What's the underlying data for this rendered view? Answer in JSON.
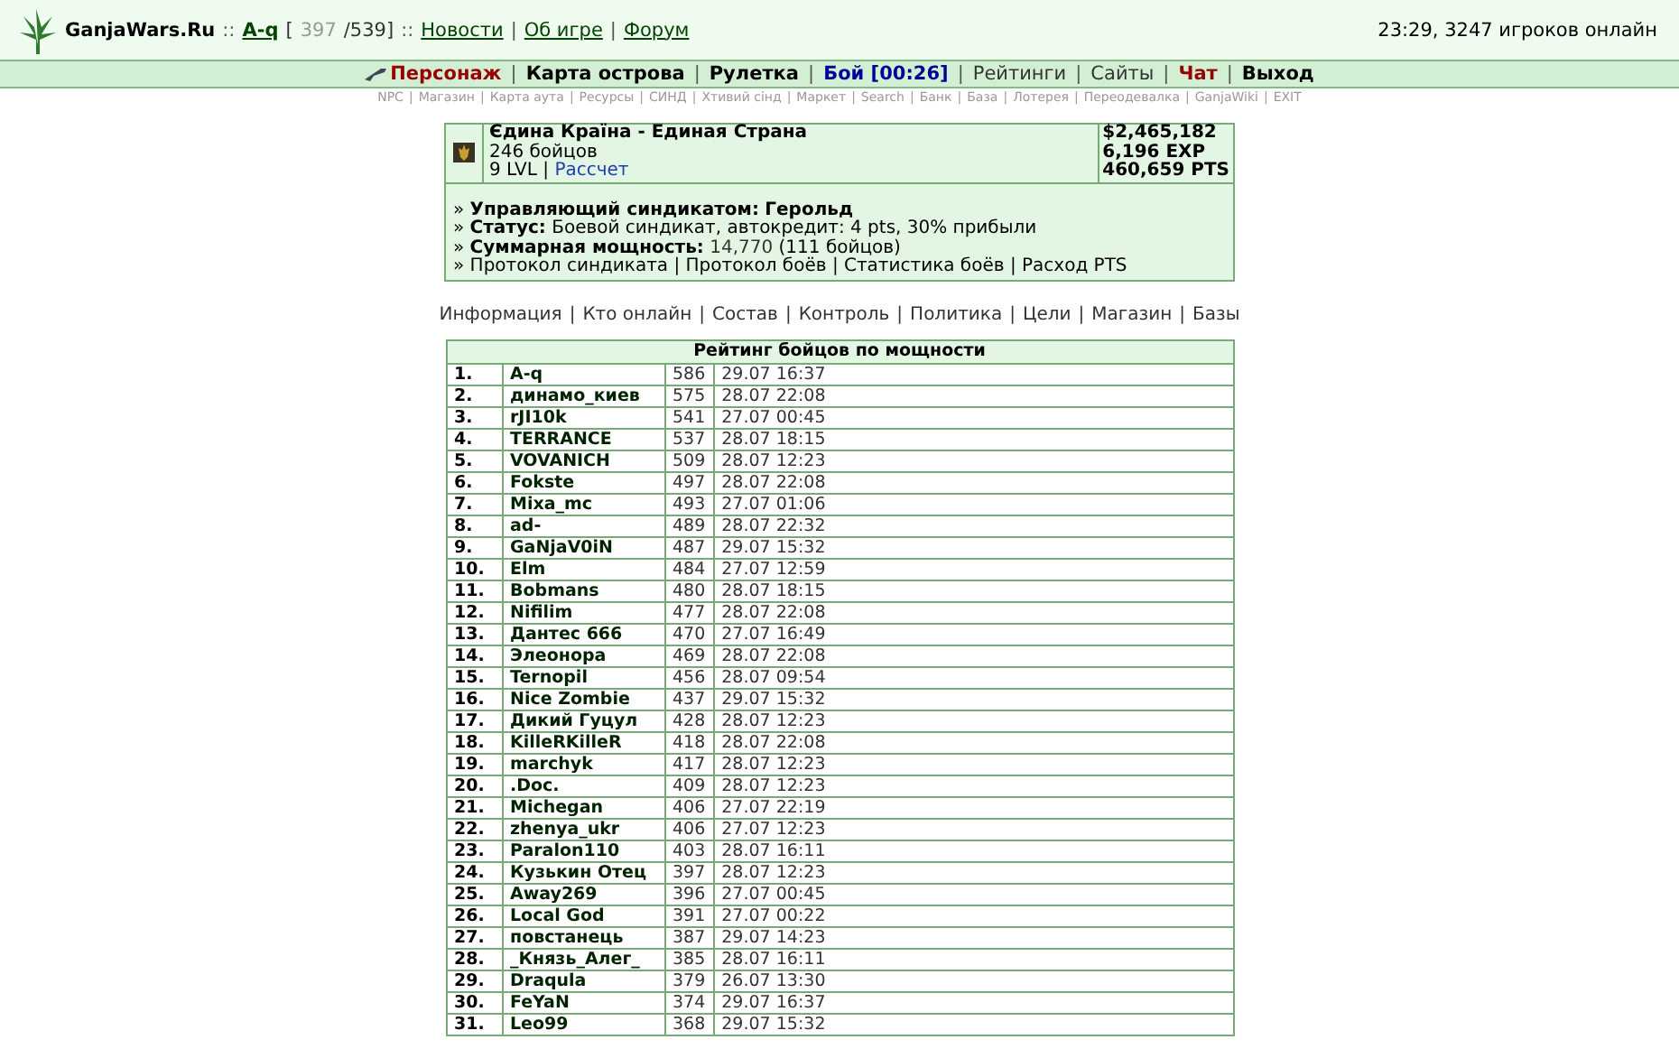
{
  "header": {
    "segments": [
      {
        "kind": "site",
        "text": "GanjaWars.Ru"
      },
      {
        "kind": "sep",
        "text": "::"
      },
      {
        "kind": "user",
        "text": "A-q"
      },
      {
        "kind": "plain",
        "text": "["
      },
      {
        "kind": "muted",
        "text": "397"
      },
      {
        "kind": "plain",
        "text": "/539]"
      },
      {
        "kind": "sep",
        "text": "::"
      },
      {
        "kind": "link",
        "text": "Новости"
      },
      {
        "kind": "sep",
        "text": "|"
      },
      {
        "kind": "link",
        "text": "Об игре"
      },
      {
        "kind": "sep",
        "text": "|"
      },
      {
        "kind": "link",
        "text": "Форум"
      }
    ],
    "status": "23:29, 3247 игроков онлайн"
  },
  "nav": {
    "separator": "|",
    "items": [
      {
        "label": "Персонаж",
        "kind": "red"
      },
      {
        "label": "Карта острова",
        "kind": "bold"
      },
      {
        "label": "Рулетка",
        "kind": "bold"
      },
      {
        "label": "Бой [00:26]",
        "kind": "blue"
      },
      {
        "label": "Рейтинги",
        "kind": "plain"
      },
      {
        "label": "Сайты",
        "kind": "plain"
      },
      {
        "label": "Чат",
        "kind": "red"
      },
      {
        "label": "Выход",
        "kind": "bold"
      }
    ]
  },
  "subnav": {
    "separator": "|",
    "items": [
      "NPC",
      "Магазин",
      "Карта аута",
      "Ресурсы",
      "СИНД",
      "Хтивий сінд",
      "Маркет",
      "Search",
      "Банк",
      "База",
      "Лотерея",
      "Переодевалка",
      "GanjaWiki",
      "EXIT"
    ]
  },
  "syndicate": {
    "name": "Єдина Країна - Единая Страна",
    "members": "246 бойцов",
    "level": "9 LVL",
    "separator": "|",
    "level_link": "Рассчет",
    "stats": [
      "$2,465,182",
      "6,196 EXP",
      "460,659 PTS"
    ],
    "lines": [
      [
        {
          "kind": "text",
          "text": "» **Управляющий синдикатом:** "
        },
        {
          "kind": "strong-link",
          "text": "Герольд"
        }
      ],
      [
        {
          "kind": "text",
          "text": "» **Статус:** Боевой синдикат, автокредит: 4 pts, 30% прибыли"
        }
      ],
      [
        {
          "kind": "text",
          "text": "» **Суммарная мощность:** "
        },
        {
          "kind": "link",
          "text": "14,770"
        },
        {
          "kind": "text",
          "text": " (111 бойцов)"
        }
      ],
      [
        {
          "kind": "text",
          "text": "» "
        },
        {
          "kind": "plain-link",
          "text": "Протокол синдиката"
        },
        {
          "kind": "text",
          "text": " | "
        },
        {
          "kind": "plain-link",
          "text": "Протокол боёв"
        },
        {
          "kind": "text",
          "text": " | "
        },
        {
          "kind": "plain-link",
          "text": "Статистика боёв"
        },
        {
          "kind": "text",
          "text": " | "
        },
        {
          "kind": "plain-link",
          "text": "Расход PTS"
        }
      ]
    ]
  },
  "tabs": {
    "separator": "|",
    "items": [
      "Информация",
      "Кто онлайн",
      "Состав",
      "Контроль",
      "Политика",
      "Цели",
      "Магазин",
      "Базы"
    ]
  },
  "table": {
    "title": "Рейтинг бойцов по мощности",
    "rows": [
      [
        "1.",
        "A-q",
        "586",
        "29.07 16:37"
      ],
      [
        "2.",
        "динамо_киев",
        "575",
        "28.07 22:08"
      ],
      [
        "3.",
        "rJI10k",
        "541",
        "27.07 00:45"
      ],
      [
        "4.",
        "TERRANCE",
        "537",
        "28.07 18:15"
      ],
      [
        "5.",
        "VOVANICH",
        "509",
        "28.07 12:23"
      ],
      [
        "6.",
        "Fokste",
        "497",
        "28.07 22:08"
      ],
      [
        "7.",
        "Mixa_mc",
        "493",
        "27.07 01:06"
      ],
      [
        "8.",
        "ad-",
        "489",
        "28.07 22:32"
      ],
      [
        "9.",
        "GaNjaV0iN",
        "487",
        "29.07 15:32"
      ],
      [
        "10.",
        "Elm",
        "484",
        "27.07 12:59"
      ],
      [
        "11.",
        "Bobmans",
        "480",
        "28.07 18:15"
      ],
      [
        "12.",
        "Nifilim",
        "477",
        "28.07 22:08"
      ],
      [
        "13.",
        "Дантес 666",
        "470",
        "27.07 16:49"
      ],
      [
        "14.",
        "Элеонора",
        "469",
        "28.07 22:08"
      ],
      [
        "15.",
        "Ternopil",
        "456",
        "28.07 09:54"
      ],
      [
        "16.",
        "Nice Zombie",
        "437",
        "29.07 15:32"
      ],
      [
        "17.",
        "Дикий Гуцул",
        "428",
        "28.07 12:23"
      ],
      [
        "18.",
        "KilleRKilleR",
        "418",
        "28.07 22:08"
      ],
      [
        "19.",
        "marchyk",
        "417",
        "28.07 12:23"
      ],
      [
        "20.",
        ".Doc.",
        "409",
        "28.07 12:23"
      ],
      [
        "21.",
        "Michegan",
        "406",
        "27.07 22:19"
      ],
      [
        "22.",
        "zhenya_ukr",
        "406",
        "27.07 12:23"
      ],
      [
        "23.",
        "Paralon110",
        "403",
        "28.07 16:11"
      ],
      [
        "24.",
        "Кузькин Отец",
        "397",
        "28.07 12:23"
      ],
      [
        "25.",
        "Away269",
        "396",
        "27.07 00:45"
      ],
      [
        "26.",
        "Local God",
        "391",
        "27.07 00:22"
      ],
      [
        "27.",
        "повстанець",
        "387",
        "29.07 14:23"
      ],
      [
        "28.",
        "_Князь_Алег_",
        "385",
        "28.07 16:11"
      ],
      [
        "29.",
        "Draqula",
        "379",
        "26.07 13:30"
      ],
      [
        "30.",
        "FeYaN",
        "374",
        "29.07 16:37"
      ],
      [
        "31.",
        "Leo99",
        "368",
        "29.07 15:32"
      ]
    ]
  }
}
